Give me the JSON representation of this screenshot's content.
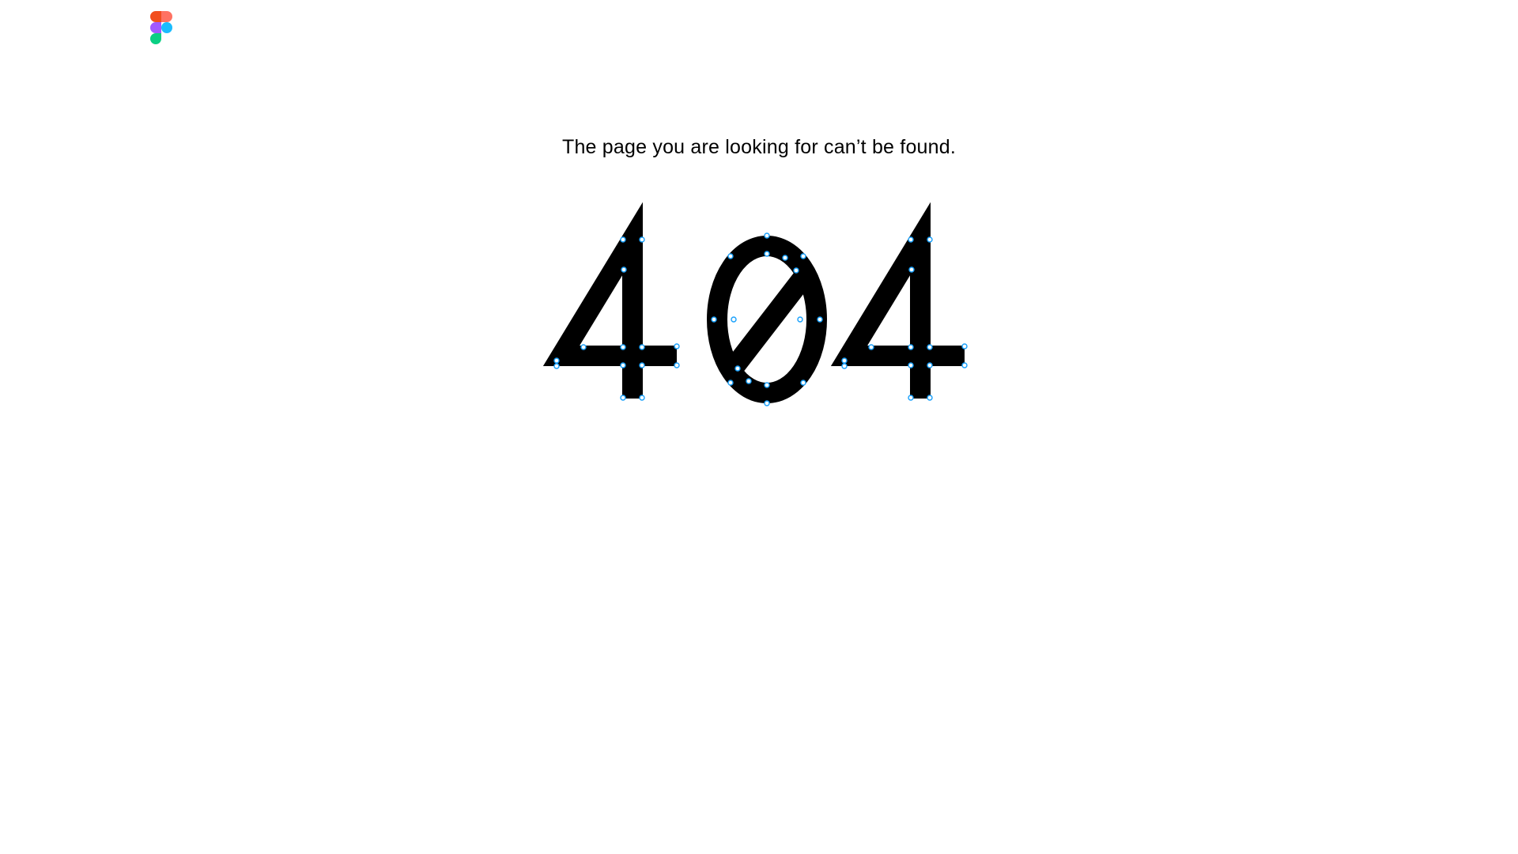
{
  "logo": {
    "icon": "figma-logo-icon",
    "colors": {
      "red": "#F24E1E",
      "orange": "#FF7262",
      "purple": "#A259FF",
      "blue": "#1ABCFE",
      "green": "#0ACF83"
    }
  },
  "message": "The page you are looking for can’t be found.",
  "error_code": "404",
  "colors": {
    "background": "#FFFFFF",
    "text": "#000000",
    "anchor_stroke": "#18A0FB"
  }
}
